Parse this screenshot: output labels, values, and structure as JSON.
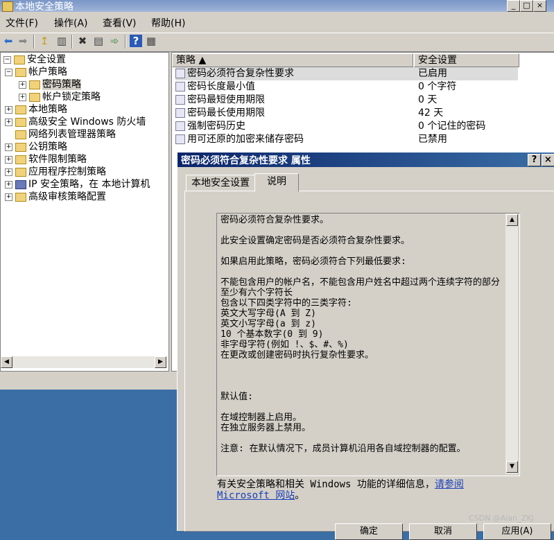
{
  "window": {
    "title": "本地安全策略"
  },
  "caption_buttons": {
    "minimize": "_",
    "maximize": "□",
    "close": "×"
  },
  "menu": [
    "文件(F)",
    "操作(A)",
    "查看(V)",
    "帮助(H)"
  ],
  "toolbar": {
    "icons": [
      "back-arrow-icon",
      "forward-arrow-icon",
      "up-folder-icon",
      "show-tree-icon",
      "delete-icon",
      "properties-icon",
      "export-icon",
      "help-icon",
      "console-icon"
    ],
    "glyphs": [
      "⬅",
      "➡",
      "↥",
      "▥",
      "✖",
      "▤",
      "➾",
      "?",
      "▦"
    ]
  },
  "tree": [
    {
      "label": "安全设置",
      "expander": "−",
      "level": 0
    },
    {
      "label": "帐户策略",
      "expander": "−",
      "level": 1
    },
    {
      "label": "密码策略",
      "expander": "+",
      "level": 2,
      "selected": true
    },
    {
      "label": "帐户锁定策略",
      "expander": "+",
      "level": 2
    },
    {
      "label": "本地策略",
      "expander": "+",
      "level": 1
    },
    {
      "label": "高级安全 Windows 防火墙",
      "expander": "+",
      "level": 1
    },
    {
      "label": "网络列表管理器策略",
      "expander": "",
      "level": 1
    },
    {
      "label": "公钥策略",
      "expander": "+",
      "level": 1
    },
    {
      "label": "软件限制策略",
      "expander": "+",
      "level": 1
    },
    {
      "label": "应用程序控制策略",
      "expander": "+",
      "level": 1
    },
    {
      "label": "IP 安全策略，在 本地计算机",
      "expander": "+",
      "level": 1
    },
    {
      "label": "高级审核策略配置",
      "expander": "+",
      "level": 1
    }
  ],
  "list": {
    "columns": [
      "策略 ▲",
      "安全设置"
    ],
    "rows": [
      {
        "policy": "密码必须符合复杂性要求",
        "setting": "已启用"
      },
      {
        "policy": "密码长度最小值",
        "setting": "0 个字符"
      },
      {
        "policy": "密码最短使用期限",
        "setting": "0 天"
      },
      {
        "policy": "密码最长使用期限",
        "setting": "42 天"
      },
      {
        "policy": "强制密码历史",
        "setting": "0 个记住的密码"
      },
      {
        "policy": "用可还原的加密来储存密码",
        "setting": "已禁用"
      }
    ]
  },
  "dialog": {
    "title": "密码必须符合复杂性要求 属性",
    "help_button": "?",
    "close_button": "×",
    "tabs": [
      "本地安全设置",
      "说明"
    ],
    "active_tab": "说明",
    "explain_text": "密码必须符合复杂性要求。\n\n此安全设置确定密码是否必须符合复杂性要求。\n\n如果启用此策略，密码必须符合下列最低要求:\n\n不能包含用户的帐户名，不能包含用户姓名中超过两个连续字符的部分\n至少有六个字符长\n包含以下四类字符中的三类字符:\n英文大写字母(A 到 Z)\n英文小写字母(a 到 z)\n10 个基本数字(0 到 9)\n非字母字符(例如 !、$、#、%)\n在更改或创建密码时执行复杂性要求。\n\n\n\n默认值:\n\n在域控制器上启用。\n在独立服务器上禁用。\n\n注意: 在默认情况下，成员计算机沿用各自域控制器的配置。",
    "footer_text": "有关安全策略和相关 Windows 功能的详细信息，",
    "footer_link": "请参阅 Microsoft 网站",
    "footer_end": "。",
    "buttons": [
      "确定",
      "取消",
      "应用(A)"
    ]
  },
  "watermark": "CSDN @Alan_ZKJ"
}
